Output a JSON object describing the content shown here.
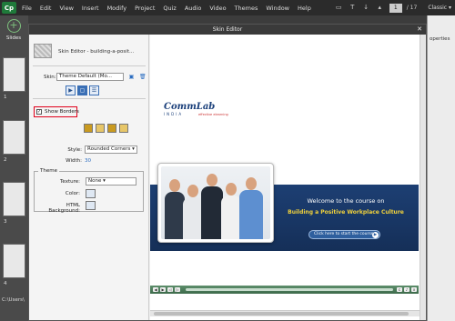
{
  "app": {
    "logo": "Cp",
    "menu": [
      "File",
      "Edit",
      "View",
      "Insert",
      "Modify",
      "Project",
      "Quiz",
      "Audio",
      "Video",
      "Themes",
      "Window",
      "Help"
    ],
    "page_current": "1",
    "page_total": "17",
    "mode": "Classic",
    "slides_label": "Slides",
    "properties_label": "operties",
    "slide_numbers": [
      "1",
      "2",
      "3",
      "4"
    ],
    "path": "C:\\Users\\"
  },
  "skin_editor": {
    "title": "Skin Editor",
    "file_name": "Skin Editor - building-a-posit...",
    "skin_label": "Skin:",
    "skin_value": "Theme Default (Mo...",
    "show_borders_label": "Show Borders",
    "style_label": "Style:",
    "style_value": "Rounded Corners",
    "width_label": "Width:",
    "width_value": "30",
    "theme_group_title": "Theme",
    "texture_label": "Texture:",
    "texture_value": "None",
    "color_label": "Color:",
    "html_background_label": "HTML Background:"
  },
  "preview": {
    "logo_text": "CommLab",
    "logo_sub": "INDIA",
    "logo_tag": "effective elearning",
    "welcome": "Welcome to the course on",
    "course_title": "Building a Positive Workplace Culture",
    "start_button": "Click here to start the course"
  },
  "colors": {
    "accent_highlight": "#e0001a",
    "banner_blue": "#1d3f73",
    "course_title_yellow": "#f2d23b",
    "playbar_green": "#4f7f5c"
  }
}
